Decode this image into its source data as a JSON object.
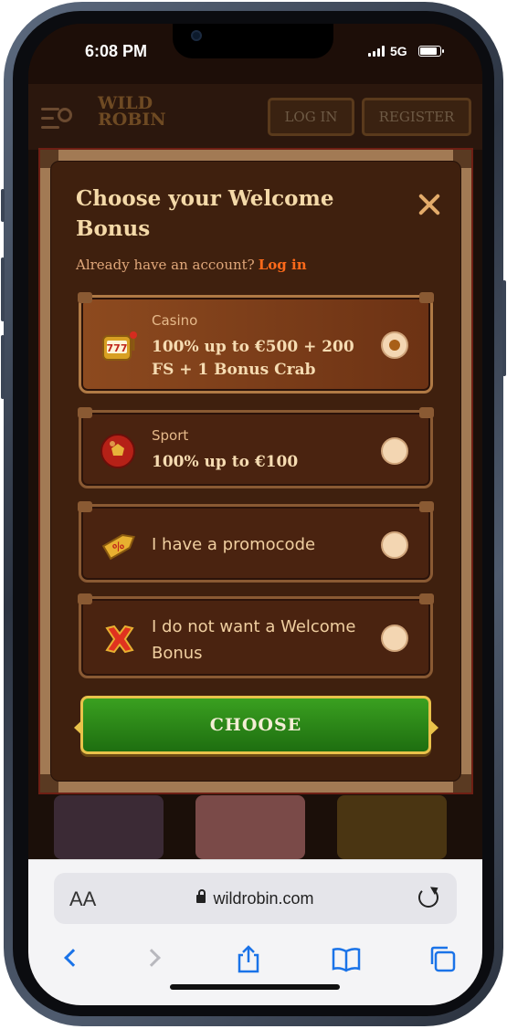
{
  "status": {
    "time": "6:08 PM",
    "network": "5G",
    "battery_level": 0.85
  },
  "site": {
    "logo_text": "WILD ROBIN",
    "login_label": "LOG IN",
    "register_label": "REGISTER"
  },
  "modal": {
    "title": "Choose your Welcome Bonus",
    "subtitle": "Already have an account?",
    "login_link": "Log in",
    "options": [
      {
        "label": "Casino",
        "text": "100% up to €500 + 200 FS + 1 Bonus Crab",
        "icon": "slot-machine-icon",
        "selected": true
      },
      {
        "label": "Sport",
        "text": "100% up to €100",
        "icon": "ball-icon",
        "selected": false
      },
      {
        "label": "",
        "text": "I have a promocode",
        "icon": "tag-icon",
        "selected": false
      },
      {
        "label": "",
        "text": "I do not want a Welcome Bonus",
        "icon": "cross-icon",
        "selected": false
      }
    ],
    "choose_label": "CHOOSE"
  },
  "browser": {
    "text_size_label": "AA",
    "url": "wildrobin.com"
  },
  "colors": {
    "accent": "#ff6a1a",
    "choose_green": "#2f8d1a",
    "modal_bg": "#3f200e"
  }
}
